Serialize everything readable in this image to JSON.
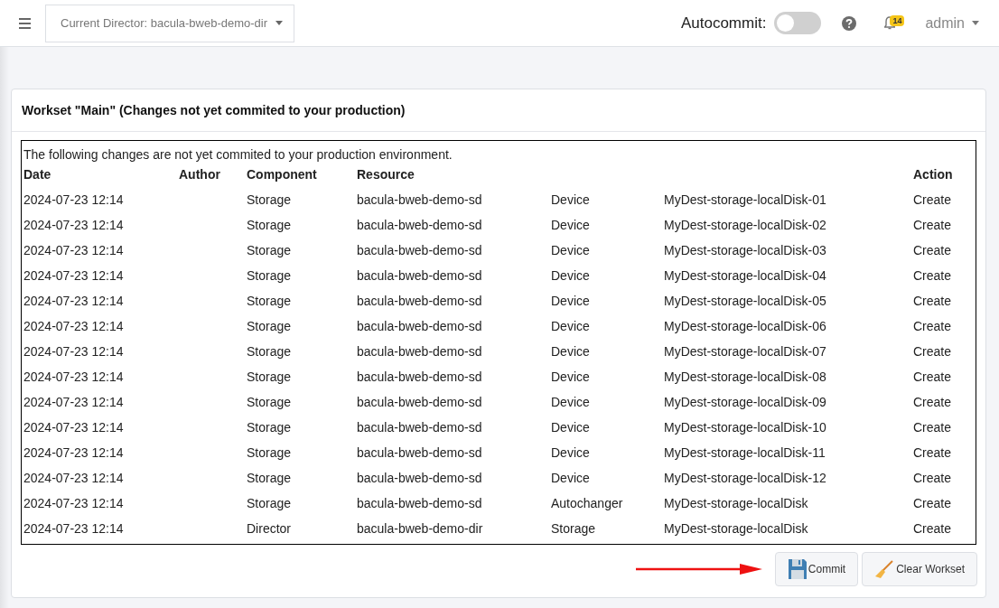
{
  "navbar": {
    "director_select": "Current Director: bacula-bweb-demo-dir",
    "autocommit_label": "Autocommit:",
    "autocommit": {
      "on": false
    },
    "notification_count": "14",
    "user": "admin"
  },
  "workset": {
    "title": "Workset \"Main\" (Changes not yet commited to your production)",
    "intro": "The following changes are not yet commited to your production environment.",
    "columns": {
      "date": "Date",
      "author": "Author",
      "component": "Component",
      "resource": "Resource",
      "action": "Action"
    },
    "rows": [
      {
        "date": "2024-07-23 12:14",
        "component": "Storage",
        "resource": "bacula-bweb-demo-sd",
        "column_5": "Device",
        "column_6": "MyDest-storage-localDisk-01",
        "action": "Create"
      },
      {
        "date": "2024-07-23 12:14",
        "component": "Storage",
        "resource": "bacula-bweb-demo-sd",
        "column_5": "Device",
        "column_6": "MyDest-storage-localDisk-02",
        "action": "Create"
      },
      {
        "date": "2024-07-23 12:14",
        "component": "Storage",
        "resource": "bacula-bweb-demo-sd",
        "column_5": "Device",
        "column_6": "MyDest-storage-localDisk-03",
        "action": "Create"
      },
      {
        "date": "2024-07-23 12:14",
        "component": "Storage",
        "resource": "bacula-bweb-demo-sd",
        "column_5": "Device",
        "column_6": "MyDest-storage-localDisk-04",
        "action": "Create"
      },
      {
        "date": "2024-07-23 12:14",
        "component": "Storage",
        "resource": "bacula-bweb-demo-sd",
        "column_5": "Device",
        "column_6": "MyDest-storage-localDisk-05",
        "action": "Create"
      },
      {
        "date": "2024-07-23 12:14",
        "component": "Storage",
        "resource": "bacula-bweb-demo-sd",
        "column_5": "Device",
        "column_6": "MyDest-storage-localDisk-06",
        "action": "Create"
      },
      {
        "date": "2024-07-23 12:14",
        "component": "Storage",
        "resource": "bacula-bweb-demo-sd",
        "column_5": "Device",
        "column_6": "MyDest-storage-localDisk-07",
        "action": "Create"
      },
      {
        "date": "2024-07-23 12:14",
        "component": "Storage",
        "resource": "bacula-bweb-demo-sd",
        "column_5": "Device",
        "column_6": "MyDest-storage-localDisk-08",
        "action": "Create"
      },
      {
        "date": "2024-07-23 12:14",
        "component": "Storage",
        "resource": "bacula-bweb-demo-sd",
        "column_5": "Device",
        "column_6": "MyDest-storage-localDisk-09",
        "action": "Create"
      },
      {
        "date": "2024-07-23 12:14",
        "component": "Storage",
        "resource": "bacula-bweb-demo-sd",
        "column_5": "Device",
        "column_6": "MyDest-storage-localDisk-10",
        "action": "Create"
      },
      {
        "date": "2024-07-23 12:14",
        "component": "Storage",
        "resource": "bacula-bweb-demo-sd",
        "column_5": "Device",
        "column_6": "MyDest-storage-localDisk-11",
        "action": "Create"
      },
      {
        "date": "2024-07-23 12:14",
        "component": "Storage",
        "resource": "bacula-bweb-demo-sd",
        "column_5": "Device",
        "column_6": "MyDest-storage-localDisk-12",
        "action": "Create"
      },
      {
        "date": "2024-07-23 12:14",
        "component": "Storage",
        "resource": "bacula-bweb-demo-sd",
        "column_5": "Autochanger",
        "column_6": "MyDest-storage-localDisk",
        "action": "Create"
      },
      {
        "date": "2024-07-23 12:14",
        "component": "Director",
        "resource": "bacula-bweb-demo-dir",
        "column_5": "Storage",
        "column_6": "MyDest-storage-localDisk",
        "action": "Create"
      }
    ],
    "buttons": [
      "Commit",
      "Clear Workset"
    ]
  }
}
